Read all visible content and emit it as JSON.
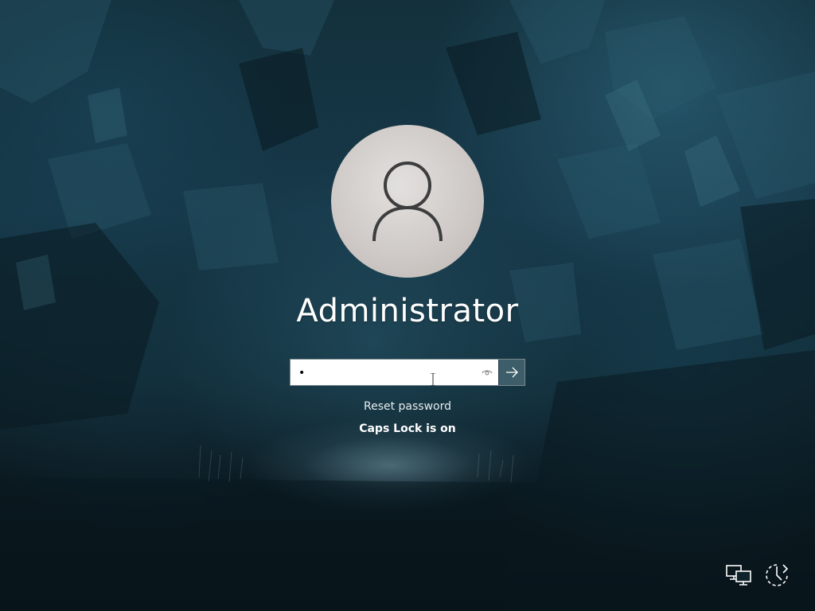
{
  "user": {
    "name": "Administrator"
  },
  "password": {
    "value": "•",
    "reveal_icon": "eye-icon",
    "submit_icon": "arrow-right-icon"
  },
  "links": {
    "reset_password": "Reset password"
  },
  "status": {
    "caps_lock": "Caps Lock is on"
  },
  "corner_icons": {
    "network": "network-icon",
    "accessibility": "ease-of-access-icon"
  },
  "colors": {
    "submit_button": "#3c5d69",
    "avatar": "#cfcac7"
  }
}
